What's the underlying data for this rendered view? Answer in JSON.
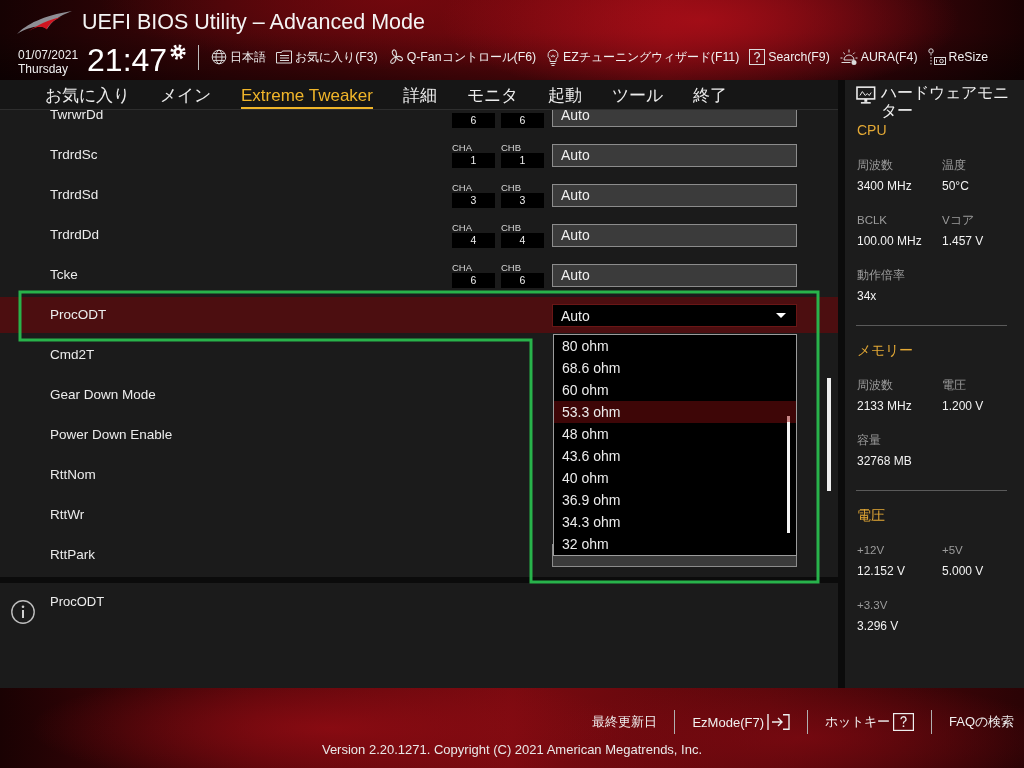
{
  "header": {
    "title": "UEFI BIOS Utility – Advanced Mode",
    "date": "01/07/2021",
    "weekday": "Thursday",
    "time": "21:47",
    "toolbar": [
      {
        "label": "日本語",
        "kind": "language"
      },
      {
        "label": "お気に入り(F3)",
        "kind": "favorites"
      },
      {
        "label": "Q-Fanコントロール(F6)",
        "kind": "fan"
      },
      {
        "label": "EZチューニングウィザード(F11)",
        "kind": "wizard"
      },
      {
        "label": "Search(F9)",
        "kind": "search"
      },
      {
        "label": "AURA(F4)",
        "kind": "aura"
      },
      {
        "label": "ReSize",
        "kind": "resize"
      }
    ]
  },
  "tabs": [
    {
      "label": "お気に入り",
      "selected": false
    },
    {
      "label": "メイン",
      "selected": false
    },
    {
      "label": "Extreme Tweaker",
      "selected": true
    },
    {
      "label": "詳細",
      "selected": false
    },
    {
      "label": "モニタ",
      "selected": false
    },
    {
      "label": "起動",
      "selected": false
    },
    {
      "label": "ツール",
      "selected": false
    },
    {
      "label": "終了",
      "selected": false
    }
  ],
  "settings": {
    "rows": [
      {
        "name": "TwrwrDd",
        "kind": "timing",
        "selected": false,
        "channels": [
          {
            "value": "6"
          },
          {
            "value": "6"
          }
        ],
        "value": "Auto"
      },
      {
        "name": "TrdrdSc",
        "kind": "timing",
        "selected": false,
        "channels": [
          {
            "label": "CHA",
            "value": "1"
          },
          {
            "label": "CHB",
            "value": "1"
          }
        ],
        "value": "Auto"
      },
      {
        "name": "TrdrdSd",
        "kind": "timing",
        "selected": false,
        "channels": [
          {
            "label": "CHA",
            "value": "3"
          },
          {
            "label": "CHB",
            "value": "3"
          }
        ],
        "value": "Auto"
      },
      {
        "name": "TrdrdDd",
        "kind": "timing",
        "selected": false,
        "channels": [
          {
            "label": "CHA",
            "value": "4"
          },
          {
            "label": "CHB",
            "value": "4"
          }
        ],
        "value": "Auto"
      },
      {
        "name": "Tcke",
        "kind": "timing",
        "selected": false,
        "channels": [
          {
            "label": "CHA",
            "value": "6"
          },
          {
            "label": "CHB",
            "value": "6"
          }
        ],
        "value": "Auto"
      },
      {
        "name": "ProcODT",
        "kind": "select",
        "selected": true,
        "expanded": true,
        "value": "Auto",
        "options": [
          {
            "label": "80 ohm",
            "selected": false
          },
          {
            "label": "68.6 ohm",
            "selected": false
          },
          {
            "label": "60 ohm",
            "selected": false
          },
          {
            "label": "53.3 ohm",
            "selected": true
          },
          {
            "label": "48 ohm",
            "selected": false
          },
          {
            "label": "43.6 ohm",
            "selected": false
          },
          {
            "label": "40 ohm",
            "selected": false
          },
          {
            "label": "36.9 ohm",
            "selected": false
          },
          {
            "label": "34.3 ohm",
            "selected": false
          },
          {
            "label": "32 ohm",
            "selected": false
          }
        ]
      },
      {
        "name": "Cmd2T",
        "kind": "covered",
        "selected": false
      },
      {
        "name": "Gear Down Mode",
        "kind": "covered",
        "selected": false
      },
      {
        "name": "Power Down Enable",
        "kind": "covered",
        "selected": false
      },
      {
        "name": "RttNom",
        "kind": "covered",
        "selected": false
      },
      {
        "name": "RttWr",
        "kind": "covered",
        "selected": false
      },
      {
        "name": "RttPark",
        "kind": "peek",
        "selected": false
      }
    ]
  },
  "help": {
    "text": "ProcODT"
  },
  "hardware_monitor": {
    "title": "ハードウェアモニター",
    "sections": [
      {
        "title": "CPU",
        "items": [
          {
            "label": "周波数",
            "value": "3400 MHz"
          },
          {
            "label": "温度",
            "value": "50°C"
          },
          {
            "label": "BCLK",
            "value": "100.00 MHz"
          },
          {
            "label": "Vコア",
            "value": "1.457 V"
          },
          {
            "label": "動作倍率",
            "value": "34x"
          }
        ]
      },
      {
        "title": "メモリー",
        "items": [
          {
            "label": "周波数",
            "value": "2133 MHz"
          },
          {
            "label": "電圧",
            "value": "1.200 V"
          },
          {
            "label": "容量",
            "value": "32768 MB"
          }
        ]
      },
      {
        "title": "電圧",
        "items": [
          {
            "label": "+12V",
            "value": "12.152 V"
          },
          {
            "label": "+5V",
            "value": "5.000 V"
          },
          {
            "label": "+3.3V",
            "value": "3.296 V"
          }
        ]
      }
    ]
  },
  "footer": {
    "links": [
      {
        "label": "最終更新日",
        "kind": "text"
      },
      {
        "label": "EzMode(F7)",
        "kind": "exit"
      },
      {
        "label": "ホットキー",
        "kind": "keys"
      },
      {
        "label": "FAQの検索",
        "kind": "text"
      }
    ],
    "copyright": "Version 2.20.1271. Copyright (C) 2021 American Megatrends, Inc."
  },
  "annotation": {
    "outline": true
  }
}
